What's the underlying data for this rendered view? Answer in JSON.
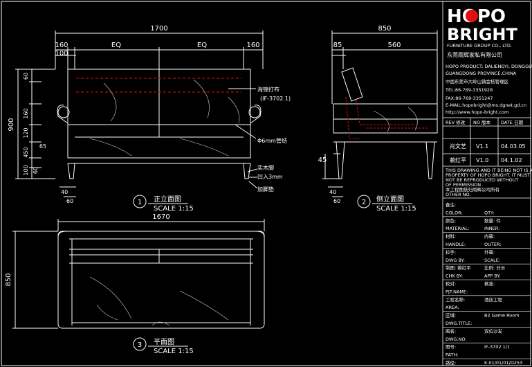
{
  "logo": {
    "line1": "HOPO",
    "line2": "BRIGHT",
    "sub": "FURNITURE GROUP CO., LTD.",
    "company_cn": "东莞雨辉家私有限公司",
    "accent": "#e01010"
  },
  "company_info": [
    "HOPO PRODUCT: DALIENGYI, DONGGUAN",
    "GUANGDONG PROVINCE,CHINA",
    "中国东莞市大岭山镇金桔管理区",
    "TEL:86-769-3351928",
    "FAX:86-769-3351247",
    "E-MAIL:hopobright@ms.dgnet.gd.cn",
    "http://www.hopo-bright.com"
  ],
  "revision": {
    "headers": [
      "REV 修改",
      "NO 版本",
      "DATE 日期"
    ],
    "rows": [
      [
        "肖文艺",
        "V1.1",
        "04.03.05"
      ],
      [
        "赖红平",
        "V1.0",
        "04.1.02"
      ]
    ]
  },
  "notes": [
    "THIS DRAWING AND IT BEING NOT IS A",
    "PROPERTY OF HOPO BRIGHT. IT MUST",
    "NOT BE REPRODUCED WITHOUT",
    "OF PERMISSION",
    "本工程图纸归雨辉公司所有",
    "OTHER NO."
  ],
  "title_block": [
    {
      "label": "备注:",
      "value": ""
    },
    {
      "label": "COLOR:",
      "value": "QTY:"
    },
    {
      "label": "颜色:",
      "value": "数量:     件"
    },
    {
      "label": "MATERIAL:",
      "value": "INNER:"
    },
    {
      "label": "材料:",
      "value": "内箱:"
    },
    {
      "label": "HANDLE:",
      "value": "OUTER:"
    },
    {
      "label": "拉手:",
      "value": "外箱:"
    },
    {
      "label": "DWG BY:",
      "value": "SCALE:"
    },
    {
      "label": "制图:  赖红平",
      "value": "比例:   分示"
    },
    {
      "label": "CHK BY:",
      "value": "APP BY:"
    },
    {
      "label": "校对:",
      "value": "核准:"
    },
    {
      "label": "PJT.NAME:",
      "value": ""
    },
    {
      "label": "工程名称:",
      "value": "酒店工程"
    },
    {
      "label": "AREA:",
      "value": ""
    },
    {
      "label": "区域:",
      "value": "B2 Game Room"
    },
    {
      "label": "DWG.TITLE:",
      "value": ""
    },
    {
      "label": "图名:",
      "value": "双位沙发"
    },
    {
      "label": "DWG.NO:",
      "value": ""
    },
    {
      "label": "图号:",
      "value": "IF-3702     1/1"
    },
    {
      "label": "PATH:",
      "value": ""
    },
    {
      "label": "路径:",
      "value": "K:01/01/01/D253"
    }
  ],
  "front_view": {
    "title": "正立面图",
    "number": "1",
    "scale": "SCALE 1:15",
    "dims_top": [
      "1700",
      "EQ",
      "EQ",
      "160",
      "160",
      "100"
    ],
    "dims_left": [
      "900",
      "60",
      "160",
      "120",
      "450",
      "65",
      "100",
      "60"
    ],
    "dims_bottom": [
      "40",
      "60"
    ],
    "callouts": [
      "海锦打布",
      "(IF-3702.1)",
      "Φ6mm管结",
      "实木脚",
      "凹入3mm",
      "加脚垫"
    ]
  },
  "side_view": {
    "title": "侧立面图",
    "number": "2",
    "scale": "SCALE 1:15",
    "dims_top": [
      "850",
      "85",
      "560"
    ],
    "dims_left": [
      "45"
    ],
    "dims_bottom": [
      "40",
      "60"
    ]
  },
  "plan_view": {
    "title": "平面图",
    "number": "3",
    "scale": "SCALE 1:15",
    "dims_top": [
      "1670"
    ],
    "dims_left": [
      "850"
    ]
  }
}
